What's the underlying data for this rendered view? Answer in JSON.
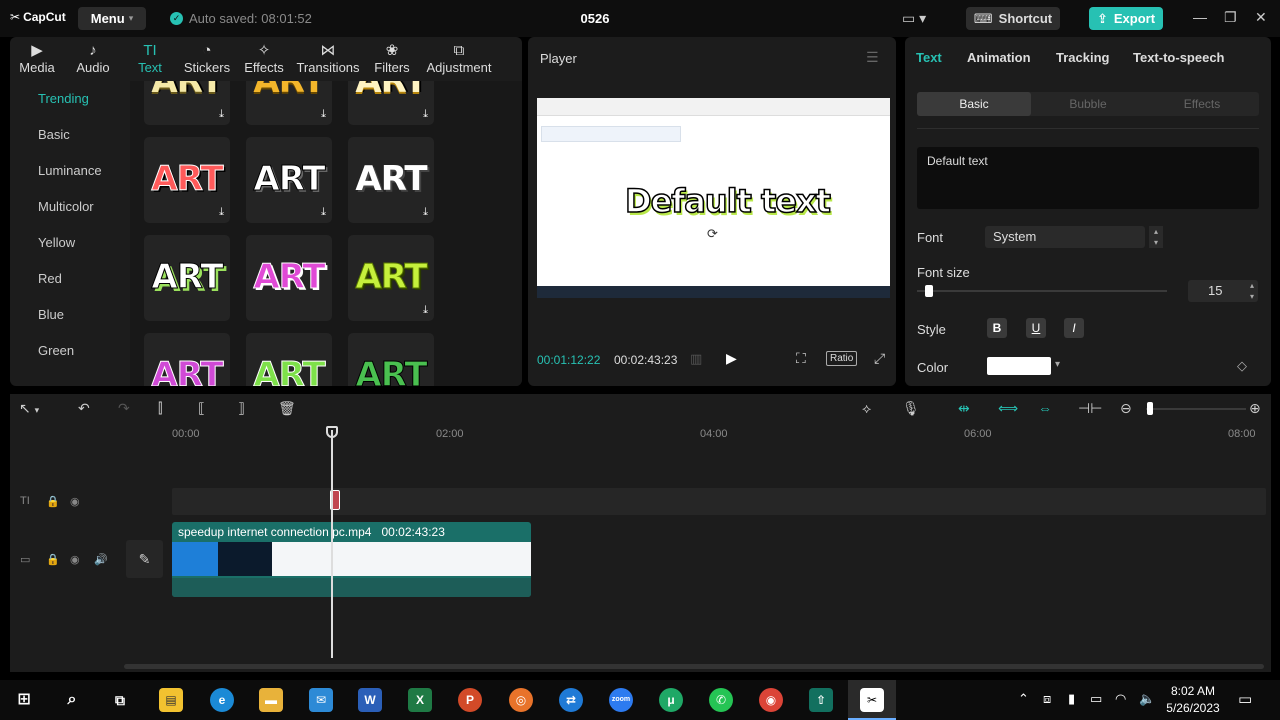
{
  "titlebar": {
    "app_name": "CapCut",
    "menu_label": "Menu",
    "autosave": "Auto saved: 08:01:52",
    "project_name": "0526",
    "shortcut_label": "Shortcut",
    "export_label": "Export"
  },
  "media_tabs": [
    {
      "label": "Media",
      "icon": "media-icon"
    },
    {
      "label": "Audio",
      "icon": "audio-icon"
    },
    {
      "label": "Text",
      "icon": "text-icon"
    },
    {
      "label": "Stickers",
      "icon": "stickers-icon"
    },
    {
      "label": "Effects",
      "icon": "effects-icon"
    },
    {
      "label": "Transitions",
      "icon": "transitions-icon"
    },
    {
      "label": "Filters",
      "icon": "filters-icon"
    },
    {
      "label": "Adjustment",
      "icon": "adjustment-icon"
    }
  ],
  "categories": [
    "Trending",
    "Basic",
    "Luminance",
    "Multicolor",
    "Yellow",
    "Red",
    "Blue",
    "Green"
  ],
  "template_text": "ART",
  "player": {
    "title": "Player",
    "overlay_text": "Default text",
    "current_time": "00:01:12:22",
    "total_time": "00:02:43:23",
    "ratio_label": "Ratio"
  },
  "inspector": {
    "tabs": [
      "Text",
      "Animation",
      "Tracking",
      "Text-to-speech"
    ],
    "subtabs": [
      "Basic",
      "Bubble",
      "Effects"
    ],
    "text_value": "Default text",
    "font_label": "Font",
    "font_value": "System",
    "font_size_label": "Font size",
    "font_size_value": "15",
    "style_label": "Style",
    "style_buttons": [
      "B",
      "U",
      "I"
    ],
    "color_label": "Color",
    "color_value": "#ffffff"
  },
  "timeline": {
    "ruler": [
      "00:00",
      "02:00",
      "04:00",
      "06:00",
      "08:00"
    ],
    "clip_name": "speedup internet connection pc.mp4",
    "clip_duration": "00:02:43:23"
  },
  "taskbar": {
    "time": "8:02 AM",
    "date": "5/26/2023"
  },
  "colors": {
    "accent": "#27c1b3",
    "panel": "#1c1c1c",
    "background": "#000000"
  }
}
